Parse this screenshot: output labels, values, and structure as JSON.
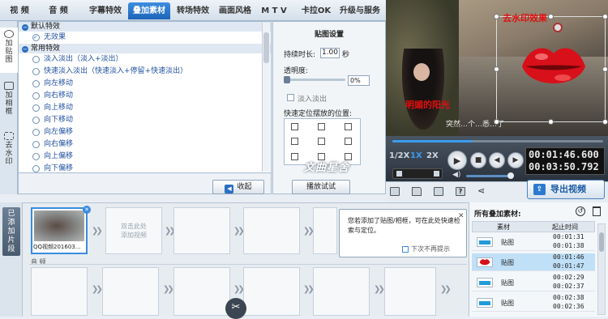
{
  "top_tabs": [
    "视 频",
    "音 频",
    "字幕特效",
    "叠加素材",
    "转场特效",
    "画面风格",
    "M T V",
    "卡拉OK",
    "升级与服务"
  ],
  "left_nav": [
    {
      "label": "加贴图",
      "icon": "sticker-icon"
    },
    {
      "label": "加相框",
      "icon": "frame-icon"
    },
    {
      "label": "去水印",
      "icon": "watermark-remove-icon"
    }
  ],
  "effects": {
    "groups": [
      {
        "label": "默认特效",
        "items": [
          {
            "label": "无效果",
            "selected": true
          }
        ]
      },
      {
        "label": "常用特效",
        "items": [
          {
            "label": "淡入淡出（淡入+淡出）"
          },
          {
            "label": "快速淡入淡出（快速淡入+停留+快速淡出）"
          },
          {
            "label": "向左移动"
          },
          {
            "label": "向右移动"
          },
          {
            "label": "向上移动"
          },
          {
            "label": "向下移动"
          },
          {
            "label": "向左偏移"
          },
          {
            "label": "向右偏移"
          },
          {
            "label": "向上偏移"
          },
          {
            "label": "向下偏移"
          }
        ]
      }
    ],
    "collapse_label": "收起"
  },
  "sticker_settings": {
    "title": "贴图设置",
    "duration_label": "持续时长:",
    "duration_value": "1.00",
    "duration_unit": "秒",
    "opacity_label": "透明度:",
    "opacity_value": "0%",
    "fade_label": "淡入淡出",
    "position_label": "快速定位摆放的位置:",
    "play_button": "播放试试"
  },
  "preview": {
    "overlay_top": "去水印效果",
    "overlay_caption": "明媚的阳光",
    "subtitle": "突然…个…悉…了"
  },
  "player": {
    "speeds": [
      "1/2X",
      "1X",
      "2X"
    ],
    "current_time": "00:01:46.600",
    "total_time": "00:03:50.792",
    "progress_fraction": 0.38,
    "volume_fraction": 0.85
  },
  "toolbar": {
    "export_label": "导出视频"
  },
  "watermark_text": "文曲星舍",
  "timeline": {
    "side_label": "已添加片段",
    "clip_name": "QQ视频201603...",
    "add_slot_text": "双击此处\n添加视频",
    "audio_label": "音 频"
  },
  "tip": {
    "text": "您若添加了贴图/相框，可在此处快速检索与定位。",
    "checkbox_label": "下次不再提示",
    "close": "✕"
  },
  "materials": {
    "title": "所有叠加素材:",
    "col_material": "素材",
    "col_time": "起止时间",
    "rows": [
      {
        "name": "贴图",
        "start": "00:01:31",
        "end": "00:01:38",
        "selected": false,
        "thumb": "bar"
      },
      {
        "name": "贴图",
        "start": "00:01:46",
        "end": "00:01:47",
        "selected": true,
        "thumb": "lips"
      },
      {
        "name": "贴图",
        "start": "00:02:29",
        "end": "00:02:37",
        "selected": false,
        "thumb": "bar"
      },
      {
        "name": "贴图",
        "start": "00:02:38",
        "end": "00:02:36",
        "selected": false,
        "thumb": "bar"
      }
    ]
  },
  "colors": {
    "accent": "#1c64b8",
    "overlay_red": "#e01010",
    "selection": "#bfe0f7"
  }
}
